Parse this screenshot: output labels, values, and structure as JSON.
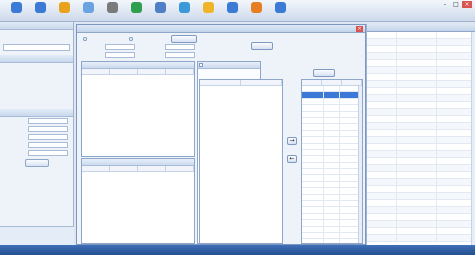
{
  "toolbar": {
    "buttons": [
      {
        "label": "",
        "icon": "user-icon",
        "color": "#3b7bd6"
      },
      {
        "label": "",
        "icon": "user-icon",
        "color": "#3b7bd6"
      },
      {
        "label": "",
        "icon": "warning-icon",
        "color": "#e8a21b"
      },
      {
        "label": "",
        "icon": "grid-icon",
        "color": "#6aa3e0"
      },
      {
        "label": "",
        "icon": "wrench-icon",
        "color": "#7a7a7a"
      },
      {
        "label": "",
        "icon": "monitor-icon",
        "color": "#2e9e4f"
      },
      {
        "label": "",
        "icon": "document-icon",
        "color": "#4f7fc4"
      },
      {
        "label": "",
        "icon": "chart-icon",
        "color": "#3a9ad9"
      },
      {
        "label": "",
        "icon": "gear-icon",
        "color": "#f0b429"
      },
      {
        "label": "",
        "icon": "help-icon",
        "color": "#3b7bd6"
      },
      {
        "label": "",
        "icon": "shield-icon",
        "color": "#e57f24"
      },
      {
        "label": "",
        "icon": "lock-icon",
        "color": "#3b7bd6"
      }
    ],
    "window_title": "",
    "win_buttons": [
      "-",
      "□",
      "×"
    ]
  },
  "left": {
    "header": "",
    "rows": [
      "",
      "",
      ""
    ],
    "section_title": "",
    "tree_items": [
      "",
      "",
      "",
      "",
      "",
      ""
    ],
    "group_title": "",
    "form_labels": [
      "",
      "",
      "",
      "",
      ""
    ],
    "search_button": "",
    "footer_tabs": [
      "",
      ""
    ],
    "footer_links": [
      "",
      ""
    ]
  },
  "dialog": {
    "title": "",
    "close": "×",
    "radio_labels": [
      "",
      ""
    ],
    "search_button": "",
    "hint_text": "",
    "filter_labels": [
      "",
      "",
      "",
      ""
    ],
    "filter_suffix": [
      "",
      "",
      ""
    ],
    "query_button": "",
    "hint_red": "",
    "checkbox_label": "",
    "selected_label": "",
    "device_label": "",
    "add_button": "",
    "top_box": {
      "title": "",
      "links": [
        "",
        ""
      ],
      "columns": [
        "",
        "",
        "",
        ""
      ]
    },
    "bottom_box": {
      "title": "",
      "links": [
        "",
        ""
      ],
      "columns": [
        "",
        "",
        "",
        ""
      ]
    },
    "right_box": {
      "title": "",
      "columns": [
        "",
        "",
        ""
      ]
    },
    "left_list": {
      "columns": [
        "",
        ""
      ]
    },
    "move_buttons": [
      "→",
      "←"
    ],
    "device_rows": [
      [
        "",
        "",
        ""
      ],
      [
        "",
        "",
        ""
      ],
      [
        "",
        "",
        ""
      ],
      [
        "",
        "",
        ""
      ],
      [
        "",
        "",
        ""
      ],
      [
        "",
        "",
        ""
      ],
      [
        "",
        "",
        ""
      ],
      [
        "",
        "",
        ""
      ],
      [
        "",
        "",
        ""
      ],
      [
        "",
        "",
        ""
      ],
      [
        "",
        "",
        ""
      ],
      [
        "",
        "",
        ""
      ],
      [
        "",
        "",
        ""
      ],
      [
        "",
        "",
        ""
      ],
      [
        "",
        "",
        ""
      ],
      [
        "",
        "",
        ""
      ],
      [
        "",
        "",
        ""
      ],
      [
        "",
        "",
        ""
      ],
      [
        "",
        "",
        ""
      ],
      [
        "",
        "",
        ""
      ],
      [
        "",
        "",
        ""
      ],
      [
        "",
        "",
        ""
      ],
      [
        "",
        "",
        ""
      ],
      [
        "",
        "",
        ""
      ],
      [
        "",
        "",
        ""
      ],
      [
        "",
        "",
        ""
      ]
    ]
  },
  "bg_table": {
    "rows": [
      [
        "",
        "",
        ""
      ],
      [
        "",
        "",
        ""
      ],
      [
        "",
        "",
        ""
      ],
      [
        "",
        "",
        ""
      ],
      [
        "",
        "",
        ""
      ],
      [
        "",
        "",
        ""
      ],
      [
        "",
        "",
        ""
      ],
      [
        "",
        "",
        ""
      ],
      [
        "",
        "",
        ""
      ],
      [
        "",
        "",
        ""
      ],
      [
        "",
        "",
        ""
      ],
      [
        "",
        "",
        ""
      ],
      [
        "",
        "",
        ""
      ],
      [
        "",
        "",
        ""
      ],
      [
        "",
        "",
        ""
      ],
      [
        "",
        "",
        ""
      ],
      [
        "",
        "",
        ""
      ],
      [
        "",
        "",
        ""
      ],
      [
        "",
        "",
        ""
      ],
      [
        "",
        "",
        ""
      ],
      [
        "",
        "",
        ""
      ],
      [
        "",
        "",
        ""
      ],
      [
        "",
        "",
        ""
      ],
      [
        "",
        "",
        ""
      ],
      [
        "",
        "",
        ""
      ],
      [
        "",
        "",
        ""
      ],
      [
        "",
        "",
        ""
      ],
      [
        "",
        "",
        ""
      ],
      [
        "",
        "",
        ""
      ],
      [
        "",
        "",
        ""
      ]
    ]
  },
  "status": {
    "items": [
      "",
      "",
      "",
      "",
      ""
    ],
    "right_items": [
      "",
      "",
      ""
    ]
  }
}
